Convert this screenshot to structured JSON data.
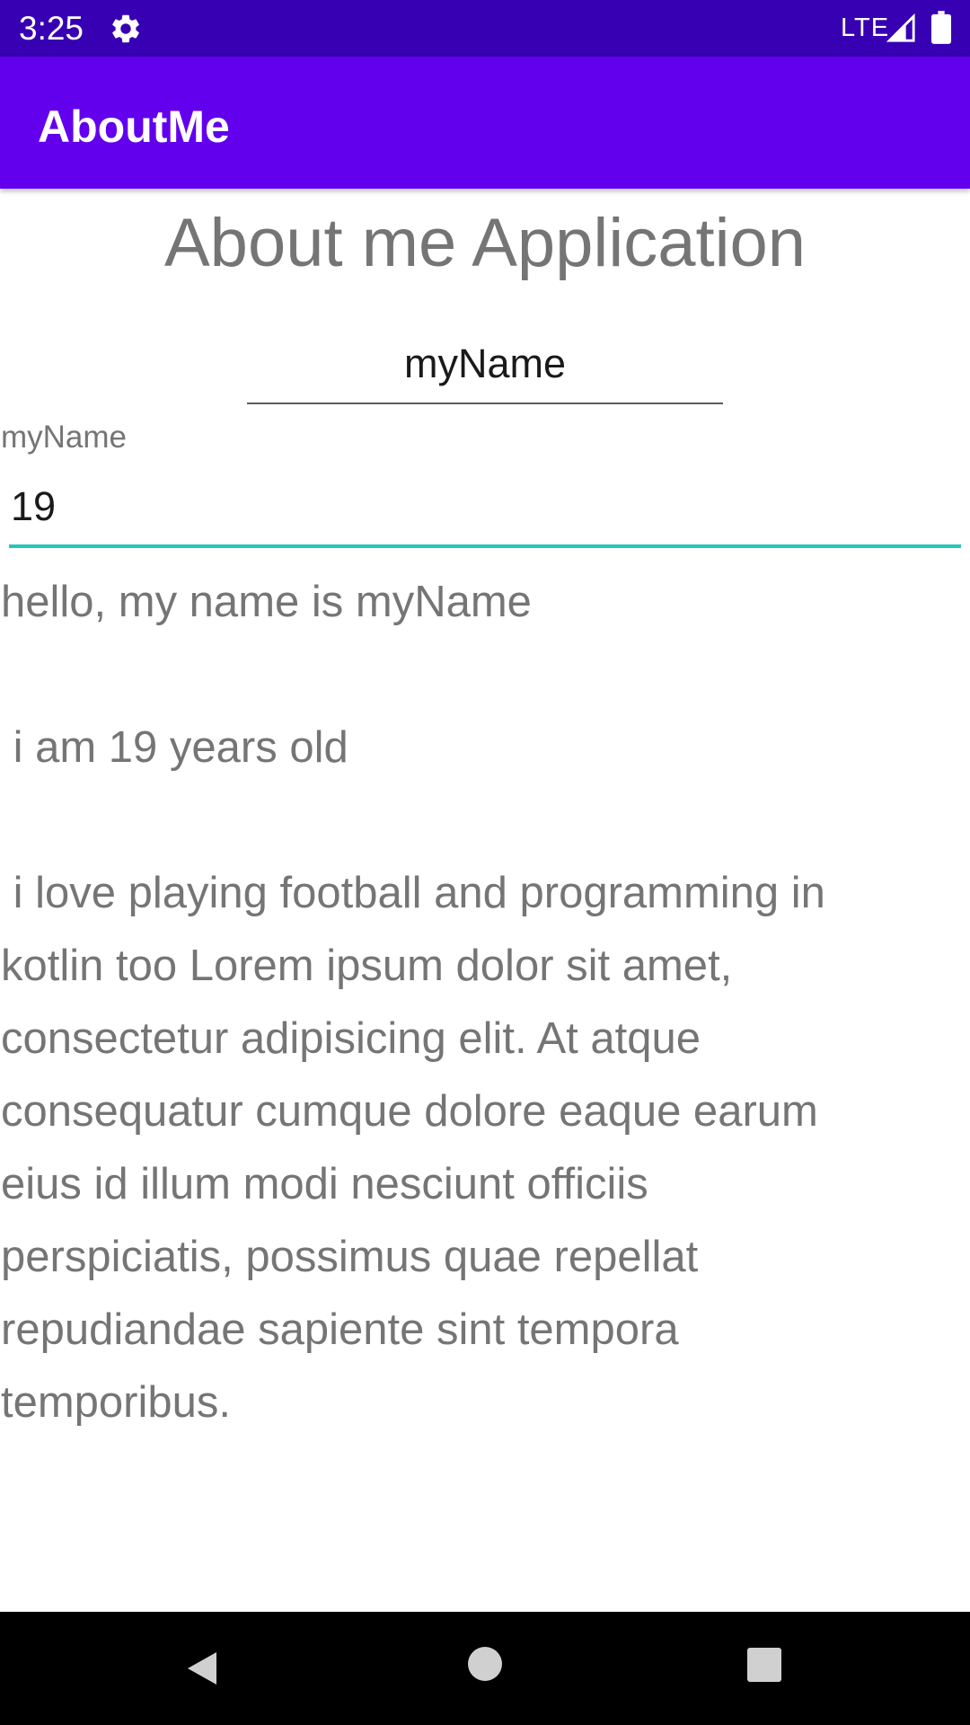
{
  "status_bar": {
    "time": "3:25",
    "network": "LTE",
    "background_color": "#3700b3"
  },
  "app_bar": {
    "title": "AboutMe",
    "background_color": "#6200ee"
  },
  "main": {
    "heading": "About me Application",
    "name_input": {
      "value": "myName"
    },
    "name_text": "myName",
    "age_input": {
      "value": "19",
      "focused": true,
      "underline_color": "#26c6b9"
    },
    "bio_text": "hello, my name is myName\n\n i am 19 years old\n\n i love playing football and programming in kotlin too Lorem ipsum dolor sit amet, consectetur adipisicing elit. At atque consequatur cumque dolore eaque earum eius id illum modi nesciunt officiis perspiciatis, possimus quae repellat repudiandae sapiente sint tempora temporibus."
  },
  "nav_bar": {
    "back_icon": "triangle-back-icon",
    "home_icon": "circle-home-icon",
    "recents_icon": "square-recents-icon"
  }
}
